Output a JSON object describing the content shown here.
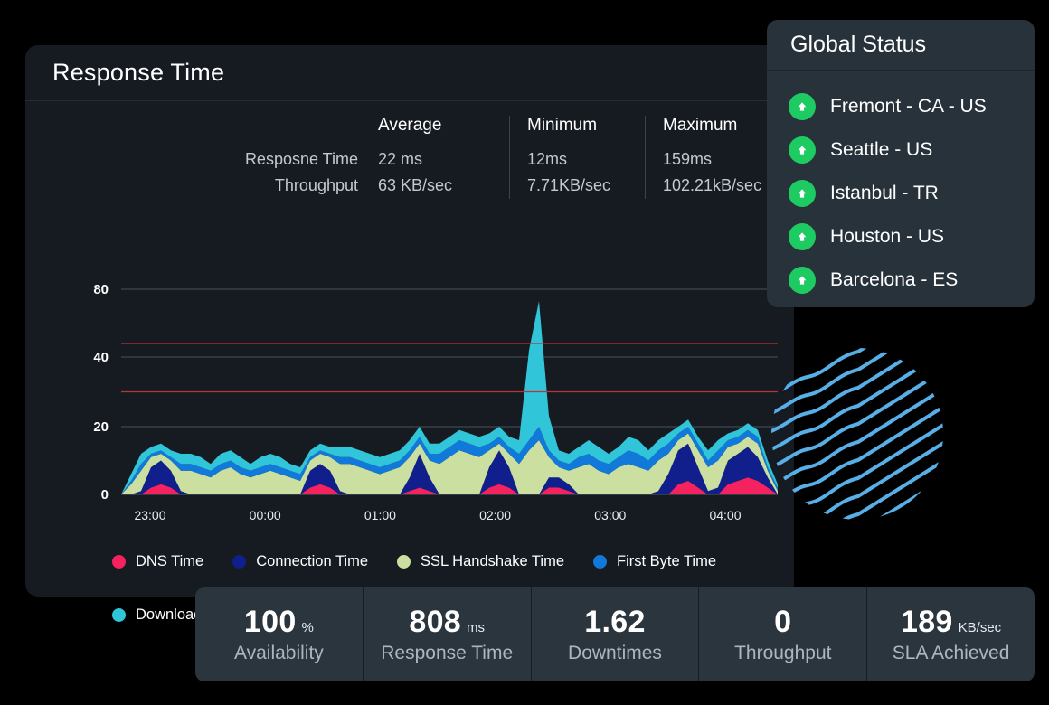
{
  "card": {
    "title": "Response Time"
  },
  "stats": {
    "columns": [
      "Average",
      "Minimum",
      "Maximum"
    ],
    "rows": [
      {
        "label": "Resposne Time",
        "average": "22 ms",
        "minimum": "12ms",
        "maximum": "159ms"
      },
      {
        "label": "Throughput",
        "average": "63 KB/sec",
        "minimum": "7.71KB/sec",
        "maximum": "102.21kB/sec"
      }
    ]
  },
  "legend": [
    {
      "label": "DNS Time",
      "color": "#f4235f",
      "icon": "legend-dot-icon"
    },
    {
      "label": "Connection Time",
      "color": "#101f8c",
      "icon": "legend-dot-icon"
    },
    {
      "label": "SSL Handshake Time",
      "color": "#cbe0a0",
      "icon": "legend-dot-icon"
    },
    {
      "label": "First Byte Time",
      "color": "#1179d9",
      "icon": "legend-dot-icon"
    },
    {
      "label": "Download Time",
      "color": "#31c5d9",
      "icon": "legend-dot-icon"
    }
  ],
  "global_status": {
    "title": "Global Status",
    "badge_color": "#1ecb63",
    "items": [
      {
        "label": "Fremont - CA - US",
        "status": "up",
        "icon": "arrow-up-icon"
      },
      {
        "label": "Seattle - US",
        "status": "up",
        "icon": "arrow-up-icon"
      },
      {
        "label": "Istanbul - TR",
        "status": "up",
        "icon": "arrow-up-icon"
      },
      {
        "label": "Houston - US",
        "status": "up",
        "icon": "arrow-up-icon"
      },
      {
        "label": "Barcelona - ES",
        "status": "up",
        "icon": "arrow-up-icon"
      }
    ]
  },
  "stat_bar": [
    {
      "value": "100",
      "unit": "%",
      "label": "Availability"
    },
    {
      "value": "808",
      "unit": "ms",
      "label": "Response Time"
    },
    {
      "value": "1.62",
      "unit": "",
      "label": "Downtimes"
    },
    {
      "value": "0",
      "unit": "",
      "label": "Throughput"
    },
    {
      "value": "189",
      "unit": "KB/sec",
      "label": "SLA Achieved"
    }
  ],
  "decoration": {
    "fingerprint_circle_color": "#58aee6"
  },
  "chart_data": {
    "type": "area",
    "title": "Response Time",
    "xlabel": "",
    "ylabel": "",
    "stacked": true,
    "grid": true,
    "legend_position": "bottom",
    "ylim": [
      0,
      80
    ],
    "ytick_labels": [
      "0",
      "20",
      "40",
      "80"
    ],
    "ytick_values": [
      0,
      20,
      40,
      80
    ],
    "xtick_labels": [
      "23:00",
      "00:00",
      "01:00",
      "02:00",
      "03:00",
      "04:00"
    ],
    "threshold_lines": [
      {
        "value": 30,
        "color": "#b9323c"
      },
      {
        "value": 48,
        "color": "#b9323c"
      }
    ],
    "x": [
      0,
      1,
      2,
      3,
      4,
      5,
      6,
      7,
      8,
      9,
      10,
      11,
      12,
      13,
      14,
      15,
      16,
      17,
      18,
      19,
      20,
      21,
      22,
      23,
      24,
      25,
      26,
      27,
      28,
      29,
      30,
      31,
      32,
      33,
      34,
      35,
      36,
      37,
      38,
      39,
      40,
      41,
      42,
      43,
      44,
      45,
      46,
      47,
      48,
      49,
      50,
      51,
      52,
      53,
      54,
      55,
      56,
      57,
      58,
      59,
      60,
      61,
      62,
      63,
      64,
      65,
      66
    ],
    "series": [
      {
        "name": "DNS Time",
        "color": "#f4235f",
        "values": [
          0,
          0,
          0,
          2,
          3,
          2,
          0,
          0,
          0,
          0,
          0,
          0,
          0,
          0,
          0,
          0,
          0,
          0,
          0,
          2,
          3,
          2,
          0,
          0,
          0,
          0,
          0,
          0,
          0,
          1,
          2,
          1,
          0,
          0,
          0,
          0,
          0,
          2,
          3,
          2,
          0,
          0,
          0,
          2,
          2,
          1,
          0,
          0,
          0,
          0,
          0,
          0,
          0,
          0,
          0,
          0,
          3,
          4,
          2,
          0,
          0,
          3,
          4,
          5,
          4,
          2,
          0
        ]
      },
      {
        "name": "Connection Time",
        "color": "#101f8c",
        "values": [
          0,
          0,
          1,
          6,
          7,
          5,
          1,
          0,
          0,
          0,
          0,
          0,
          0,
          0,
          0,
          0,
          0,
          0,
          0,
          5,
          6,
          5,
          1,
          0,
          0,
          0,
          0,
          0,
          0,
          4,
          10,
          4,
          0,
          0,
          0,
          0,
          0,
          6,
          10,
          6,
          0,
          0,
          0,
          3,
          3,
          2,
          0,
          0,
          0,
          0,
          0,
          0,
          0,
          0,
          1,
          6,
          10,
          11,
          6,
          1,
          2,
          7,
          8,
          9,
          7,
          3,
          0
        ]
      },
      {
        "name": "SSL Handshake Time",
        "color": "#cbe0a0",
        "values": [
          0,
          3,
          6,
          3,
          2,
          3,
          6,
          7,
          6,
          5,
          7,
          8,
          6,
          5,
          6,
          7,
          6,
          5,
          4,
          3,
          3,
          4,
          8,
          9,
          8,
          7,
          6,
          7,
          8,
          6,
          3,
          5,
          9,
          11,
          13,
          12,
          11,
          5,
          2,
          4,
          9,
          13,
          16,
          6,
          3,
          4,
          8,
          9,
          7,
          6,
          8,
          9,
          8,
          7,
          9,
          6,
          3,
          3,
          5,
          7,
          8,
          4,
          3,
          3,
          4,
          2,
          1
        ]
      },
      {
        "name": "First Byte Time",
        "color": "#1179d9",
        "values": [
          0,
          1,
          2,
          1,
          1,
          1,
          2,
          2,
          2,
          2,
          2,
          2,
          2,
          2,
          2,
          2,
          2,
          2,
          2,
          1,
          1,
          1,
          2,
          2,
          2,
          2,
          2,
          2,
          2,
          2,
          2,
          2,
          3,
          3,
          3,
          3,
          3,
          2,
          2,
          2,
          3,
          3,
          4,
          2,
          2,
          2,
          3,
          3,
          3,
          3,
          3,
          4,
          4,
          3,
          3,
          3,
          2,
          2,
          2,
          2,
          3,
          2,
          2,
          2,
          2,
          1,
          1
        ]
      },
      {
        "name": "Download Time",
        "color": "#31c5d9",
        "values": [
          0,
          2,
          3,
          2,
          2,
          2,
          3,
          3,
          3,
          2,
          3,
          3,
          3,
          2,
          3,
          3,
          3,
          2,
          2,
          2,
          2,
          2,
          3,
          3,
          3,
          3,
          3,
          3,
          3,
          3,
          3,
          3,
          3,
          3,
          3,
          3,
          3,
          3,
          3,
          3,
          4,
          28,
          53,
          10,
          3,
          3,
          3,
          4,
          4,
          3,
          3,
          4,
          4,
          3,
          3,
          3,
          2,
          2,
          2,
          3,
          3,
          2,
          2,
          2,
          2,
          2,
          1
        ]
      }
    ]
  }
}
